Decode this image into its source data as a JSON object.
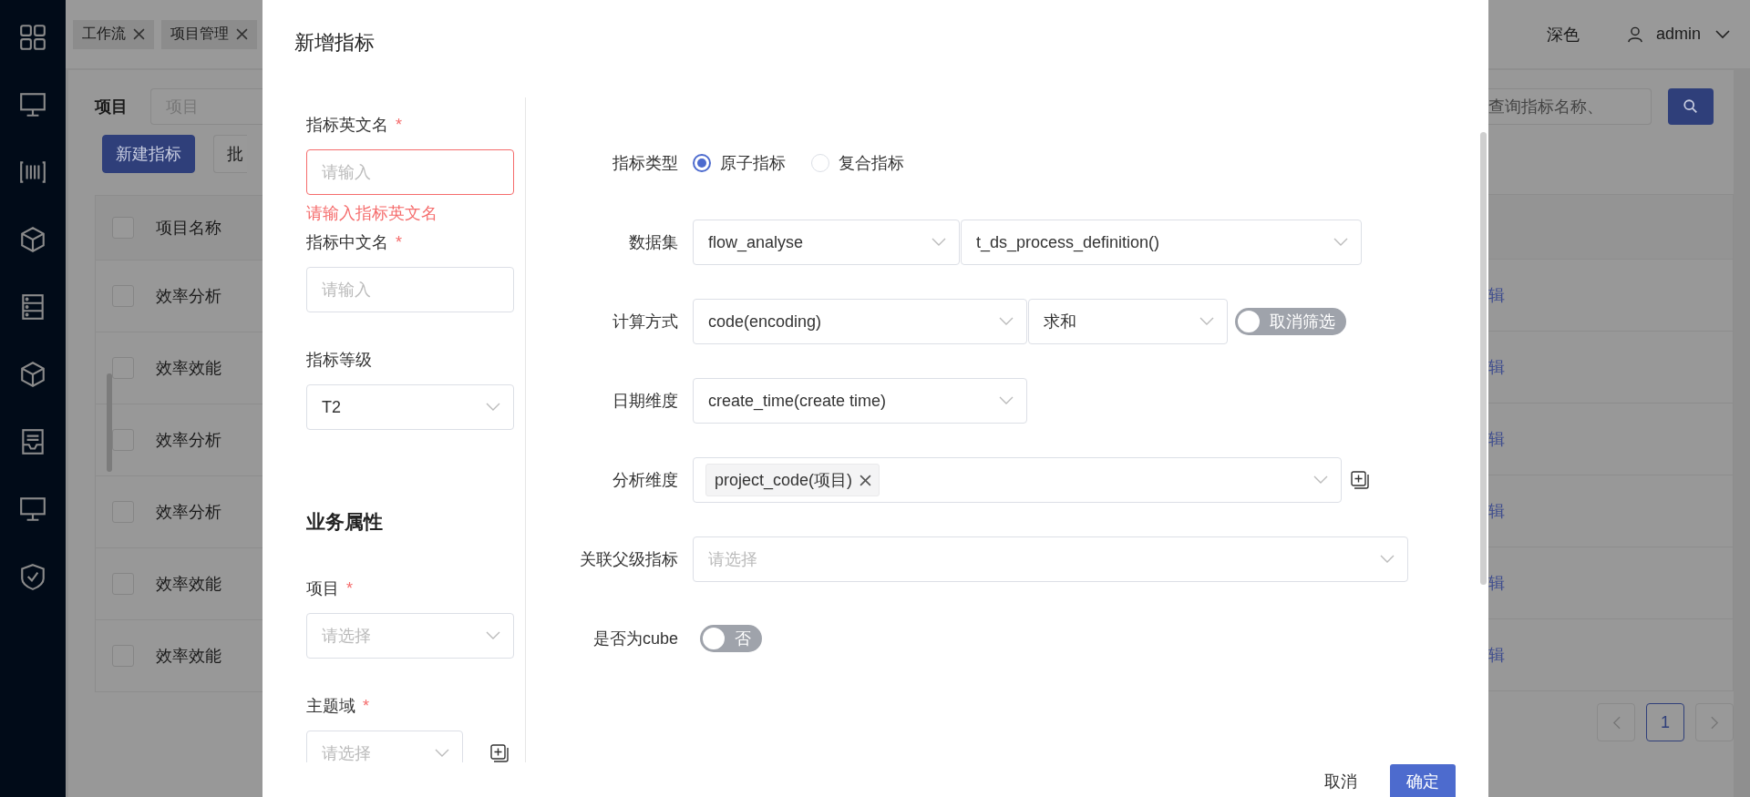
{
  "top_bar": {
    "tabs": [
      {
        "label": "工作流"
      },
      {
        "label": "项目管理"
      }
    ],
    "theme_label": "深色",
    "user": "admin"
  },
  "page": {
    "filter_label": "项目",
    "filter_placeholder": "项目",
    "search_placeholder": "查询指标名称、",
    "buttons": [
      {
        "label": "新建指标",
        "kind": "primary"
      },
      {
        "label": "批",
        "kind": "default"
      }
    ],
    "table": {
      "header_checked": false,
      "columns": [
        "项目名称"
      ],
      "rows": [
        {
          "checked": false,
          "name": "效率分析",
          "action": "辑"
        },
        {
          "checked": false,
          "name": "效率效能",
          "action": "辑"
        },
        {
          "checked": false,
          "name": "效率分析",
          "action": "辑"
        },
        {
          "checked": false,
          "name": "效率分析",
          "action": "辑"
        },
        {
          "checked": false,
          "name": "效率效能",
          "action": "辑"
        },
        {
          "checked": false,
          "name": "效率效能",
          "action": "辑"
        }
      ]
    },
    "pagination": {
      "pages": [
        {
          "label": "1",
          "selected": true
        }
      ]
    }
  },
  "dialog": {
    "title": "新增指标",
    "left_fields": [
      {
        "kind": "input",
        "label": "指标英文名",
        "required_mark": "*",
        "placeholder": "请输入",
        "error": "请输入指标英文名"
      },
      {
        "kind": "input",
        "label": "指标中文名",
        "required_mark": "*",
        "placeholder": "请输入"
      },
      {
        "kind": "select",
        "label": "指标等级",
        "value": "T2"
      },
      {
        "kind": "heading",
        "label": "业务属性"
      },
      {
        "kind": "select",
        "label": "项目",
        "required_mark": "*",
        "placeholder": "请选择"
      },
      {
        "kind": "select",
        "label": "主题域",
        "required_mark": "*",
        "placeholder": "请选择",
        "add_button": true
      }
    ],
    "right_rows": [
      {
        "kind": "radio",
        "label": "指标类型",
        "options": [
          {
            "label": "原子指标",
            "selected": true
          },
          {
            "label": "复合指标",
            "selected": false
          }
        ]
      },
      {
        "kind": "selects",
        "label": "数据集",
        "selects": [
          {
            "value": "flow_analyse"
          },
          {
            "value": "t_ds_process_definition()"
          }
        ]
      },
      {
        "kind": "selects",
        "label": "计算方式",
        "selects": [
          {
            "value": "code(encoding)"
          },
          {
            "value": "求和"
          }
        ],
        "switch": {
          "label": "取消筛选",
          "on": false
        }
      },
      {
        "kind": "selects",
        "label": "日期维度",
        "selects": [
          {
            "value": "create_time(create time)"
          }
        ]
      },
      {
        "kind": "tags",
        "label": "分析维度",
        "tags": [
          "project_code(项目)"
        ],
        "add_button": true
      },
      {
        "kind": "selects",
        "label": "关联父级指标",
        "selects": [
          {
            "placeholder": "请选择"
          }
        ]
      },
      {
        "kind": "switch",
        "label": "是否为cube",
        "switch": {
          "label": "否",
          "on": false
        }
      }
    ],
    "footer": {
      "cancel": "取消",
      "ok": "确定"
    }
  }
}
